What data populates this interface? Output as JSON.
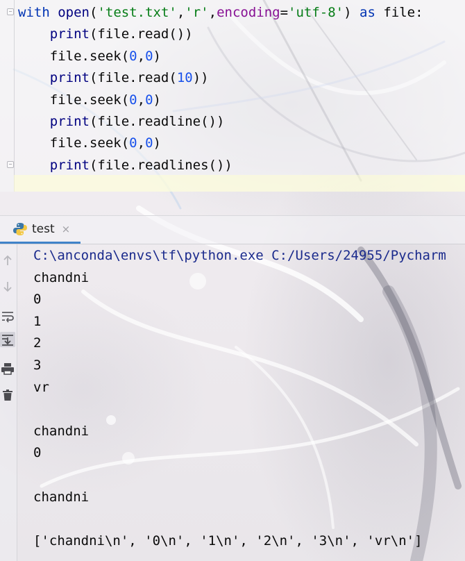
{
  "editor": {
    "lines": [
      [
        {
          "t": "with",
          "c": "kw"
        },
        {
          "t": " "
        },
        {
          "t": "open",
          "c": "fn"
        },
        {
          "t": "("
        },
        {
          "t": "'test.txt'",
          "c": "str"
        },
        {
          "t": ","
        },
        {
          "t": "'r'",
          "c": "str"
        },
        {
          "t": ","
        },
        {
          "t": "encoding",
          "c": "param"
        },
        {
          "t": "="
        },
        {
          "t": "'utf-8'",
          "c": "str"
        },
        {
          "t": ") "
        },
        {
          "t": "as",
          "c": "kw"
        },
        {
          "t": " file:"
        }
      ],
      [
        {
          "t": "    "
        },
        {
          "t": "print",
          "c": "fn"
        },
        {
          "t": "(file.read())"
        }
      ],
      [
        {
          "t": "    file.seek("
        },
        {
          "t": "0",
          "c": "num"
        },
        {
          "t": ","
        },
        {
          "t": "0",
          "c": "num"
        },
        {
          "t": ")"
        }
      ],
      [
        {
          "t": "    "
        },
        {
          "t": "print",
          "c": "fn"
        },
        {
          "t": "(file.read("
        },
        {
          "t": "10",
          "c": "num"
        },
        {
          "t": "))"
        }
      ],
      [
        {
          "t": "    file.seek("
        },
        {
          "t": "0",
          "c": "num"
        },
        {
          "t": ","
        },
        {
          "t": "0",
          "c": "num"
        },
        {
          "t": ")"
        }
      ],
      [
        {
          "t": "    "
        },
        {
          "t": "print",
          "c": "fn"
        },
        {
          "t": "(file.readline())"
        }
      ],
      [
        {
          "t": "    file.seek("
        },
        {
          "t": "0",
          "c": "num"
        },
        {
          "t": ","
        },
        {
          "t": "0",
          "c": "num"
        },
        {
          "t": ")"
        }
      ],
      [
        {
          "t": "    "
        },
        {
          "t": "print",
          "c": "fn"
        },
        {
          "t": "(file.readlines())"
        }
      ]
    ]
  },
  "run_panel": {
    "tab_label": "test",
    "tab_icon": "python-icon",
    "close_glyph": "×",
    "tools": [
      "rerun-up-icon",
      "scroll-down-icon",
      "soft-wrap-icon",
      "scroll-to-end-icon",
      "print-icon",
      "trash-icon"
    ]
  },
  "console": {
    "lines": [
      "C:\\anconda\\envs\\tf\\python.exe C:/Users/24955/Pycharm",
      "chandni",
      "0",
      "1",
      "2",
      "3",
      "vr",
      "",
      "chandni",
      "0",
      "",
      "chandni",
      "",
      "['chandni\\n', '0\\n', '1\\n', '2\\n', '3\\n', 'vr\\n']"
    ]
  },
  "colors": {
    "keyword": "#0033b3",
    "string": "#067d17",
    "number": "#1750eb",
    "param": "#871094",
    "tab_underline": "#4083c9"
  }
}
